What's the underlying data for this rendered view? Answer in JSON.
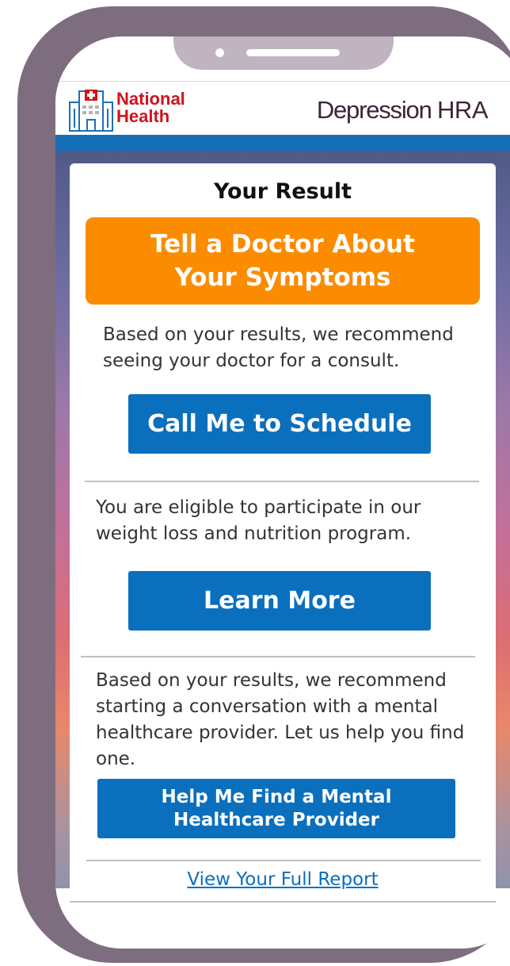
{
  "header": {
    "logo_text_line1": "National",
    "logo_text_line2": "Health",
    "title_main": "Depression",
    "title_suffix": "HRA"
  },
  "result": {
    "heading": "Your Result",
    "alert_line1": "Tell a Doctor About",
    "alert_line2": "Your Symptoms"
  },
  "sections": [
    {
      "text": "Based on your results, we recommend seeing your doctor for a consult.",
      "button_label": "Call Me to Schedule"
    },
    {
      "text": "You are eligible to participate in our weight loss and nutrition program.",
      "button_label": "Learn More"
    },
    {
      "text": "Based on your results, we recommend starting a conversation with a mental healthcare provider. Let us help you find one.",
      "button_line1": "Help Me Find a Mental",
      "button_line2": "Healthcare Provider"
    }
  ],
  "footer": {
    "report_link": "View Your Full Report"
  },
  "colors": {
    "phone_frame": "#7e6d7e",
    "header_band": "#1670b8",
    "alert": "#fb8c00",
    "button": "#0a6fbd",
    "logo_red": "#d0121b",
    "title": "#3d2436"
  },
  "icons": {
    "logo": "hospital-icon"
  }
}
